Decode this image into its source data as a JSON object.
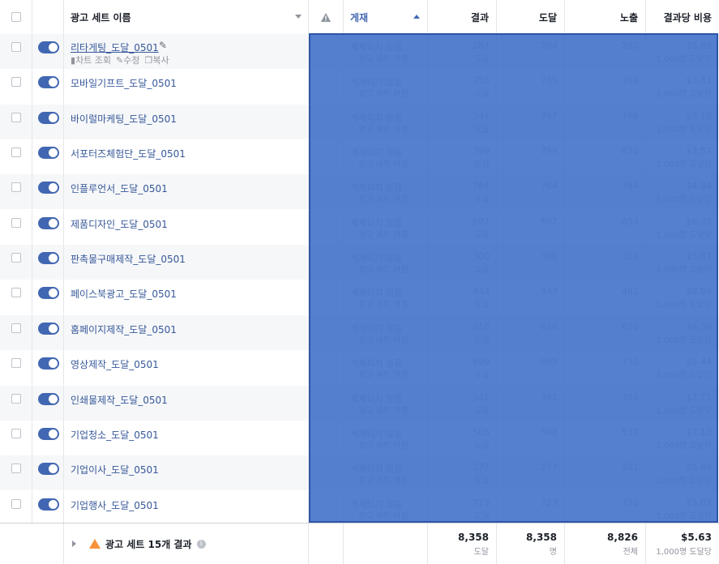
{
  "header": {
    "name": "광고 세트 이름",
    "status": "게재",
    "results": "결과",
    "reach": "도달",
    "impressions": "노출",
    "cost": "결과당 비용"
  },
  "first_row_actions": {
    "chart": "차트 조회",
    "edit": "수정",
    "copy": "복사"
  },
  "ghost_status": "게재되지 않음",
  "ghost_status_sub": "광고 세트 꺼짐",
  "ghost_unit_result": "도달",
  "ghost_unit_cost": "1,000명 도달당",
  "rows": [
    {
      "name": "리타게팅_도달_0501",
      "results": "284",
      "reach": "284",
      "impressions": "292",
      "cost": "$5.88"
    },
    {
      "name": "모바일기프트_도달_0501",
      "results": "755",
      "reach": "755",
      "impressions": "769",
      "cost": "$3.81"
    },
    {
      "name": "바이럴마케팅_도달_0501",
      "results": "747",
      "reach": "747",
      "impressions": "766",
      "cost": "$5.10"
    },
    {
      "name": "서포터즈체험단_도달_0501",
      "results": "799",
      "reach": "799",
      "impressions": "832",
      "cost": "$3.57"
    },
    {
      "name": "인플루언서_도달_0501",
      "results": "764",
      "reach": "764",
      "impressions": "794",
      "cost": "$4.84"
    },
    {
      "name": "제품디자인_도달_0501",
      "results": "607",
      "reach": "607",
      "impressions": "633",
      "cost": "$6.33"
    },
    {
      "name": "판촉물구매제작_도달_0501",
      "results": "300",
      "reach": "300",
      "impressions": "311",
      "cost": "$5.87"
    },
    {
      "name": "페이스북광고_도달_0501",
      "results": "443",
      "reach": "443",
      "impressions": "462",
      "cost": "$8.08"
    },
    {
      "name": "홈페이지제작_도달_0501",
      "results": "616",
      "reach": "616",
      "impressions": "626",
      "cost": "$6.30"
    },
    {
      "name": "영상제작_도달_0501",
      "results": "699",
      "reach": "699",
      "impressions": "731",
      "cost": "$5.44"
    },
    {
      "name": "인쇄물제작_도달_0501",
      "results": "341",
      "reach": "341",
      "impressions": "355",
      "cost": "$7.71"
    },
    {
      "name": "기업청소_도달_0501",
      "results": "508",
      "reach": "508",
      "impressions": "537",
      "cost": "$7.13"
    },
    {
      "name": "기업이사_도달_0501",
      "results": "277",
      "reach": "277",
      "impressions": "281",
      "cost": "$5.85"
    },
    {
      "name": "기업행사_도달_0501",
      "results": "723",
      "reach": "723",
      "impressions": "752",
      "cost": "$5.03"
    }
  ],
  "footer": {
    "label": "광고 세트 15개 결과",
    "results": "8,358",
    "results_unit": "도달",
    "reach": "8,358",
    "reach_unit": "명",
    "impressions": "8,826",
    "impressions_unit": "전체",
    "cost": "$5.63",
    "cost_unit": "1,000명 도달당"
  },
  "colors": {
    "toggle_on": "#4267b2",
    "link": "#365899",
    "selection": "#3e6ec8",
    "warning": "#f7923b"
  }
}
